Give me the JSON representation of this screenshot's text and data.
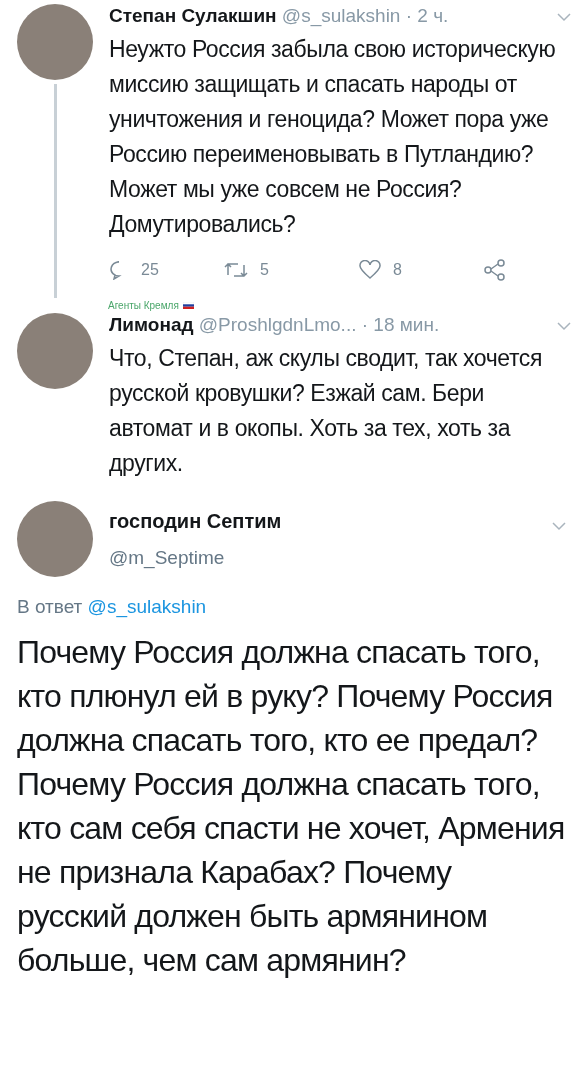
{
  "thread": [
    {
      "name": "Степан Сулакшин",
      "handle": "@s_sulakshin",
      "time": "· 2 ч.",
      "text": "Неужто Россия забыла свою историческую миссию защищать и спасать народы от уничтожения и геноцида? Может пора уже Россию переименовывать в Путландию? Может мы уже совсем не Россия? Домутировались?",
      "thread_line": true,
      "actions": {
        "replies": "25",
        "retweets": "5",
        "likes": "8"
      }
    },
    {
      "name": "Лимонад",
      "handle": "@ProshlgdnLmo...",
      "time": "· 18 мин.",
      "label": "Агенты Кремля",
      "text": "Что, Степан, аж скулы сводит, так хочется русской кровушки? Езжай сам. Бери автомат и в окопы. Хоть за тех, хоть за других.",
      "thread_line": false
    }
  ],
  "main_tweet": {
    "name": "господин Септим",
    "handle": "@m_Septime",
    "reply_prefix": "В ответ",
    "reply_to": "@s_sulakshin",
    "text": "Почему Россия должна спасать того, кто плюнул ей в руку? Почему Россия должна спасать того, кто ее предал? Почему Россия должна спасать того, кто сам себя спасти не хочет, Армения не признала Карабах? Почему русский должен быть армянином больше, чем сам армянин?"
  }
}
